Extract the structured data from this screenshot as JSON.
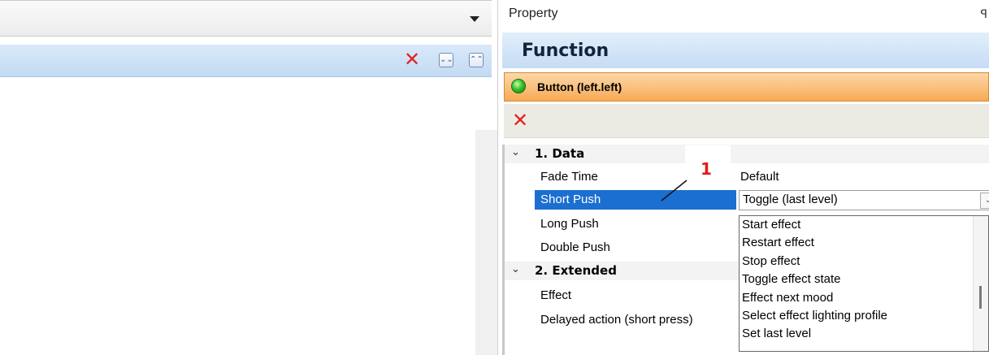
{
  "left_pane": {
    "toolbar": {
      "delete_icon": "close-x-red",
      "expand_all_icon": "chevrons-down",
      "collapse_all_icon": "chevrons-up"
    }
  },
  "property_panel": {
    "header_title": "Property",
    "pin_icon": "pin",
    "function_title": "Function",
    "selected_object": {
      "status_icon": "green-led",
      "label": "Button (left.left)"
    },
    "action_bar": {
      "delete_icon": "close-x-red"
    },
    "categories": [
      {
        "label": "1. Data",
        "properties": [
          {
            "name": "Fade Time",
            "value": "Default"
          },
          {
            "name": "Short Push",
            "value": "Toggle (last level)",
            "selected": true
          },
          {
            "name": "Long Push",
            "value": ""
          },
          {
            "name": "Double Push",
            "value": ""
          }
        ]
      },
      {
        "label": "2. Extended",
        "properties": [
          {
            "name": "Effect",
            "value": ""
          },
          {
            "name": "Delayed action (short press)",
            "value": ""
          }
        ]
      }
    ],
    "dropdown_options": [
      "Start effect",
      "Restart effect",
      "Stop effect",
      "Toggle effect state",
      "Effect next mood",
      "Select effect lighting profile",
      "Set last level"
    ]
  },
  "annotation": {
    "callout_number": "1"
  },
  "colors": {
    "selection": "#1b6fd1",
    "button_bar": "#f7aa55",
    "delete_red": "#e02222",
    "callout_red": "#e01b1b"
  }
}
